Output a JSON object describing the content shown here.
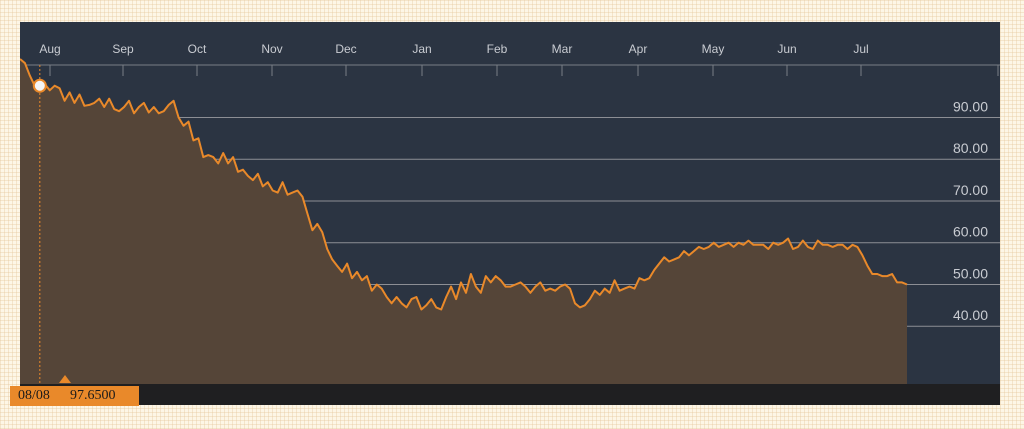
{
  "chart_data": {
    "type": "area",
    "x_ticks": [
      "Aug",
      "Sep",
      "Oct",
      "Nov",
      "Dec",
      "Jan",
      "Feb",
      "Mar",
      "Apr",
      "May",
      "Jun",
      "Jul"
    ],
    "y_ticks": [
      "90.00",
      "80.00",
      "70.00",
      "60.00",
      "50.00",
      "40.00"
    ],
    "ylim": [
      34.5,
      107
    ],
    "grid": true,
    "series": [
      {
        "values": [
          104,
          103,
          100,
          97.5,
          97.6,
          98,
          96.5,
          97.6,
          97,
          94,
          96,
          93.5,
          95.5,
          92.8,
          93,
          93.5,
          94.5,
          92.5,
          94.5,
          92,
          91.5,
          92.5,
          94,
          91,
          92.5,
          93.5,
          91.2,
          92.5,
          91,
          91.5,
          93,
          94,
          90,
          88,
          89,
          84.5,
          85,
          80.5,
          81,
          80.5,
          79,
          81.5,
          79,
          80.5,
          77,
          77.5,
          76,
          75,
          76.5,
          73.5,
          74.5,
          72.5,
          72,
          74.5,
          71.5,
          72,
          72.5,
          71,
          67,
          63,
          64.5,
          62.5,
          58.5,
          56,
          54.5,
          53,
          55,
          51.5,
          53,
          51,
          52,
          48.5,
          50,
          49,
          47,
          45.5,
          47,
          45.5,
          44.5,
          46.5,
          47,
          44,
          45,
          46.5,
          44.5,
          44,
          47,
          49.5,
          46.5,
          50.5,
          48,
          52.5,
          49.5,
          48,
          52,
          50.5,
          52,
          51,
          49.5,
          49.5,
          50,
          50.5,
          49.5,
          48,
          49.5,
          50.5,
          48.5,
          49,
          48.5,
          49.5,
          50,
          49,
          45.5,
          44.5,
          45,
          46.5,
          48.5,
          47.5,
          49,
          48,
          51,
          48.5,
          49,
          49.5,
          49,
          51.5,
          51,
          51.5,
          53.5,
          55,
          56.5,
          55.5,
          56,
          56.5,
          58,
          57,
          58,
          59,
          58.5,
          59,
          60,
          59,
          59.5,
          60,
          59,
          60,
          59.5,
          60.5,
          59.5,
          59.5,
          59.5,
          58.5,
          60,
          59.5,
          60,
          61,
          58.5,
          59,
          60.5,
          59,
          58.5,
          60.5,
          59.5,
          59.5,
          59,
          59.5,
          59.5,
          58.5,
          59.5,
          59,
          57,
          54.5,
          52.5,
          52.5,
          52,
          52,
          52.5,
          50.5,
          50.5,
          50
        ]
      }
    ],
    "marker": {
      "index": 4,
      "date": "08/08",
      "value": "97.6500"
    },
    "colors": {
      "line": "#e9892a",
      "fill": "#554538",
      "background": "#2b3442",
      "grid": "#8c8e94",
      "text": "#c9ccd2"
    }
  }
}
